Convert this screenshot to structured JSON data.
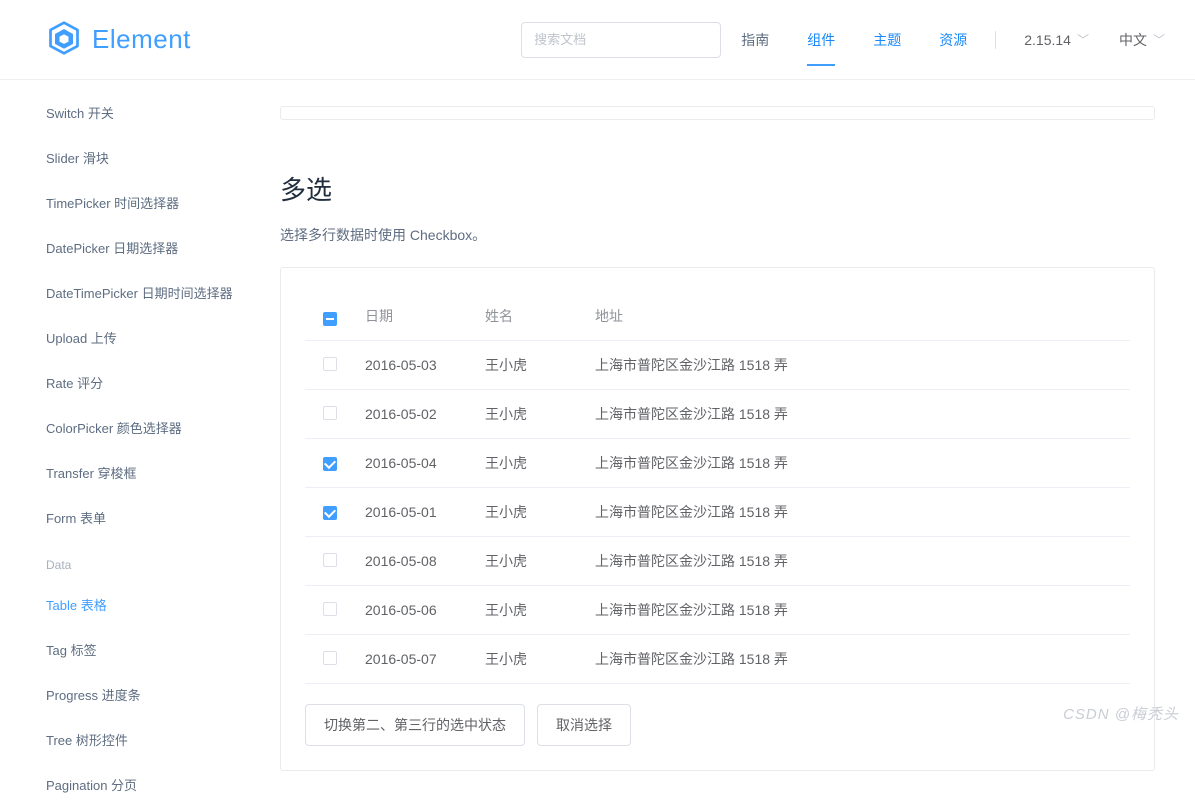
{
  "logo": {
    "text": "Element"
  },
  "search": {
    "placeholder": "搜索文档"
  },
  "nav": {
    "guide": "指南",
    "component": "组件",
    "theme": "主题",
    "resource": "资源",
    "version": "2.15.14",
    "lang": "中文"
  },
  "sidebar": {
    "items": [
      "Switch 开关",
      "Slider 滑块",
      "TimePicker 时间选择器",
      "DatePicker 日期选择器",
      "DateTimePicker 日期时间选择器",
      "Upload 上传",
      "Rate 评分",
      "ColorPicker 颜色选择器",
      "Transfer 穿梭框",
      "Form 表单"
    ],
    "group": "Data",
    "data_items": [
      "Table 表格",
      "Tag 标签",
      "Progress 进度条",
      "Tree 树形控件",
      "Pagination 分页"
    ]
  },
  "section": {
    "title": "多选",
    "desc": "选择多行数据时使用 Checkbox。"
  },
  "table": {
    "headers": {
      "date": "日期",
      "name": "姓名",
      "address": "地址"
    },
    "rows": [
      {
        "checked": false,
        "date": "2016-05-03",
        "name": "王小虎",
        "address": "上海市普陀区金沙江路 1518 弄"
      },
      {
        "checked": false,
        "date": "2016-05-02",
        "name": "王小虎",
        "address": "上海市普陀区金沙江路 1518 弄"
      },
      {
        "checked": true,
        "date": "2016-05-04",
        "name": "王小虎",
        "address": "上海市普陀区金沙江路 1518 弄"
      },
      {
        "checked": true,
        "date": "2016-05-01",
        "name": "王小虎",
        "address": "上海市普陀区金沙江路 1518 弄"
      },
      {
        "checked": false,
        "date": "2016-05-08",
        "name": "王小虎",
        "address": "上海市普陀区金沙江路 1518 弄"
      },
      {
        "checked": false,
        "date": "2016-05-06",
        "name": "王小虎",
        "address": "上海市普陀区金沙江路 1518 弄"
      },
      {
        "checked": false,
        "date": "2016-05-07",
        "name": "王小虎",
        "address": "上海市普陀区金沙江路 1518 弄"
      }
    ]
  },
  "actions": {
    "toggle": "切换第二、第三行的选中状态",
    "clear": "取消选择"
  },
  "watermark": "CSDN @梅秃头"
}
